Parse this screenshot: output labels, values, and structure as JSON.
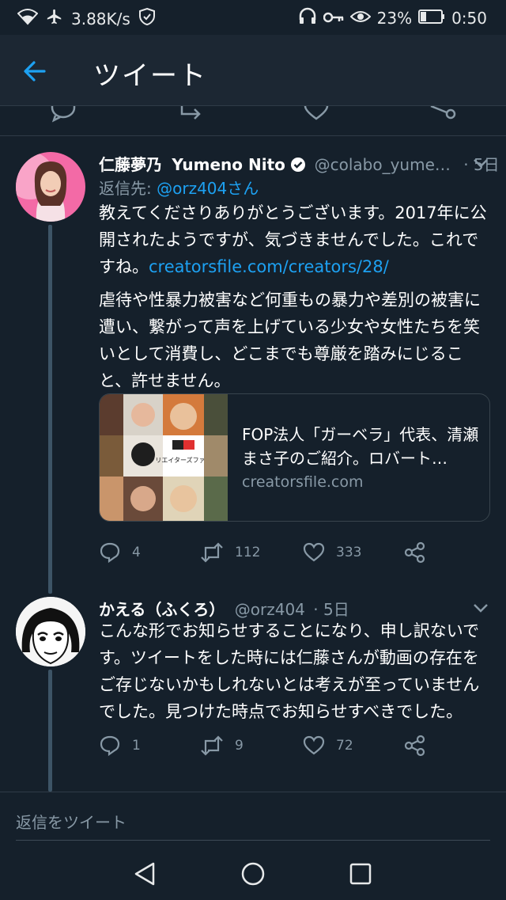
{
  "status_bar": {
    "speed": "3.88K/s",
    "battery": "23%",
    "time": "0:50",
    "icons": [
      "wifi-icon",
      "airplane-icon",
      "shield-icon",
      "headphones-icon",
      "key-icon",
      "eye-icon",
      "battery-icon"
    ]
  },
  "header": {
    "title": "ツイート",
    "back_icon": "arrow-left-icon"
  },
  "tweets": [
    {
      "name": "仁藤夢乃",
      "name_en": "Yumeno Nito",
      "verified": true,
      "handle": "@colabo_yume…",
      "time": "· 5日",
      "reply_to_label": "返信先:",
      "reply_to_handle": "@orz404さん",
      "text_part1": "教えてくださりありがとうございます。2017年に公開されたようですが、気づきませんでした。これですね。",
      "link": "creatorsfile.com/creators/28/",
      "text_part2": "虐待や性暴力被害など何重もの暴力や差別の被害に遭い、繋がって声を上げている少女や女性たちを笑いとして消費し、どこまでも尊厳を踏みにじること、許せません。",
      "card": {
        "title": "FOP法人「ガーベラ」代表、清瀬まさ子のご紹介。ロバート…",
        "domain": "creatorsfile.com",
        "thumb_text": "クリエイターズファイル"
      },
      "stats": {
        "replies": "4",
        "retweets": "112",
        "likes": "333"
      }
    },
    {
      "name": "かえる（ふくろ）",
      "handle": "@orz404",
      "time": "· 5日",
      "text": "こんな形でお知らせすることになり、申し訳ないです。ツイートをした時には仁藤さんが動画の存在をご存じないかもしれないとは考えが至っていませんでした。見つけた時点でお知らせすべきでした。",
      "stats": {
        "replies": "1",
        "retweets": "9",
        "likes": "72"
      }
    }
  ],
  "reply_bar": {
    "placeholder": "返信をツイート"
  },
  "colors": {
    "background": "#15202b",
    "accent": "#1da1f2",
    "muted": "#8899a6",
    "header": "#1c2733"
  }
}
